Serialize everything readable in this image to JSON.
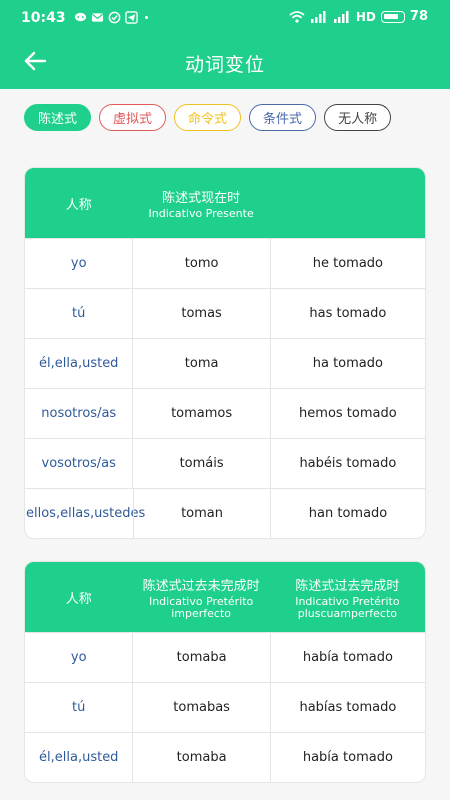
{
  "status_bar": {
    "time": "10:43",
    "network_label": "HD",
    "battery": "78"
  },
  "app_bar": {
    "title": "动词变位"
  },
  "mood_tabs": [
    {
      "label": "陈述式",
      "color": "#1fd08c",
      "active": true
    },
    {
      "label": "虚拟式",
      "color": "#e05a5a",
      "active": false
    },
    {
      "label": "命令式",
      "color": "#f0c020",
      "active": false
    },
    {
      "label": "条件式",
      "color": "#4a6aaa",
      "active": false
    },
    {
      "label": "无人称",
      "color": "#444444",
      "active": false
    }
  ],
  "table1": {
    "header": {
      "person": "人称",
      "col2_cn": "陈述式现在时",
      "col2_es": "Indicativo Presente"
    },
    "rows": [
      {
        "person": "yo",
        "simple": "tomo",
        "compound": "he tomado"
      },
      {
        "person": "tú",
        "simple": "tomas",
        "compound": "has tomado"
      },
      {
        "person": "él,ella,usted",
        "simple": "toma",
        "compound": "ha tomado"
      },
      {
        "person": "nosotros/as",
        "simple": "tomamos",
        "compound": "hemos tomado"
      },
      {
        "person": "vosotros/as",
        "simple": "tomáis",
        "compound": "habéis tomado"
      },
      {
        "person": "ellos,ellas,ustedes",
        "simple": "toman",
        "compound": "han tomado"
      }
    ]
  },
  "table2": {
    "header": {
      "person": "人称",
      "col2_cn": "陈述式过去未完成时",
      "col2_es_1": "Indicativo Pretérito",
      "col2_es_2": "imperfecto",
      "col3_cn": "陈述式过去完成时",
      "col3_es_1": "Indicativo Pretérito",
      "col3_es_2": "pluscuamperfecto"
    },
    "rows": [
      {
        "person": "yo",
        "simple": "tomaba",
        "compound": "había tomado"
      },
      {
        "person": "tú",
        "simple": "tomabas",
        "compound": "habías tomado"
      },
      {
        "person": "él,ella,usted",
        "simple": "tomaba",
        "compound": "había tomado"
      }
    ]
  },
  "colors": {
    "accent": "#1fd08c",
    "person_text": "#2f5a9a"
  }
}
